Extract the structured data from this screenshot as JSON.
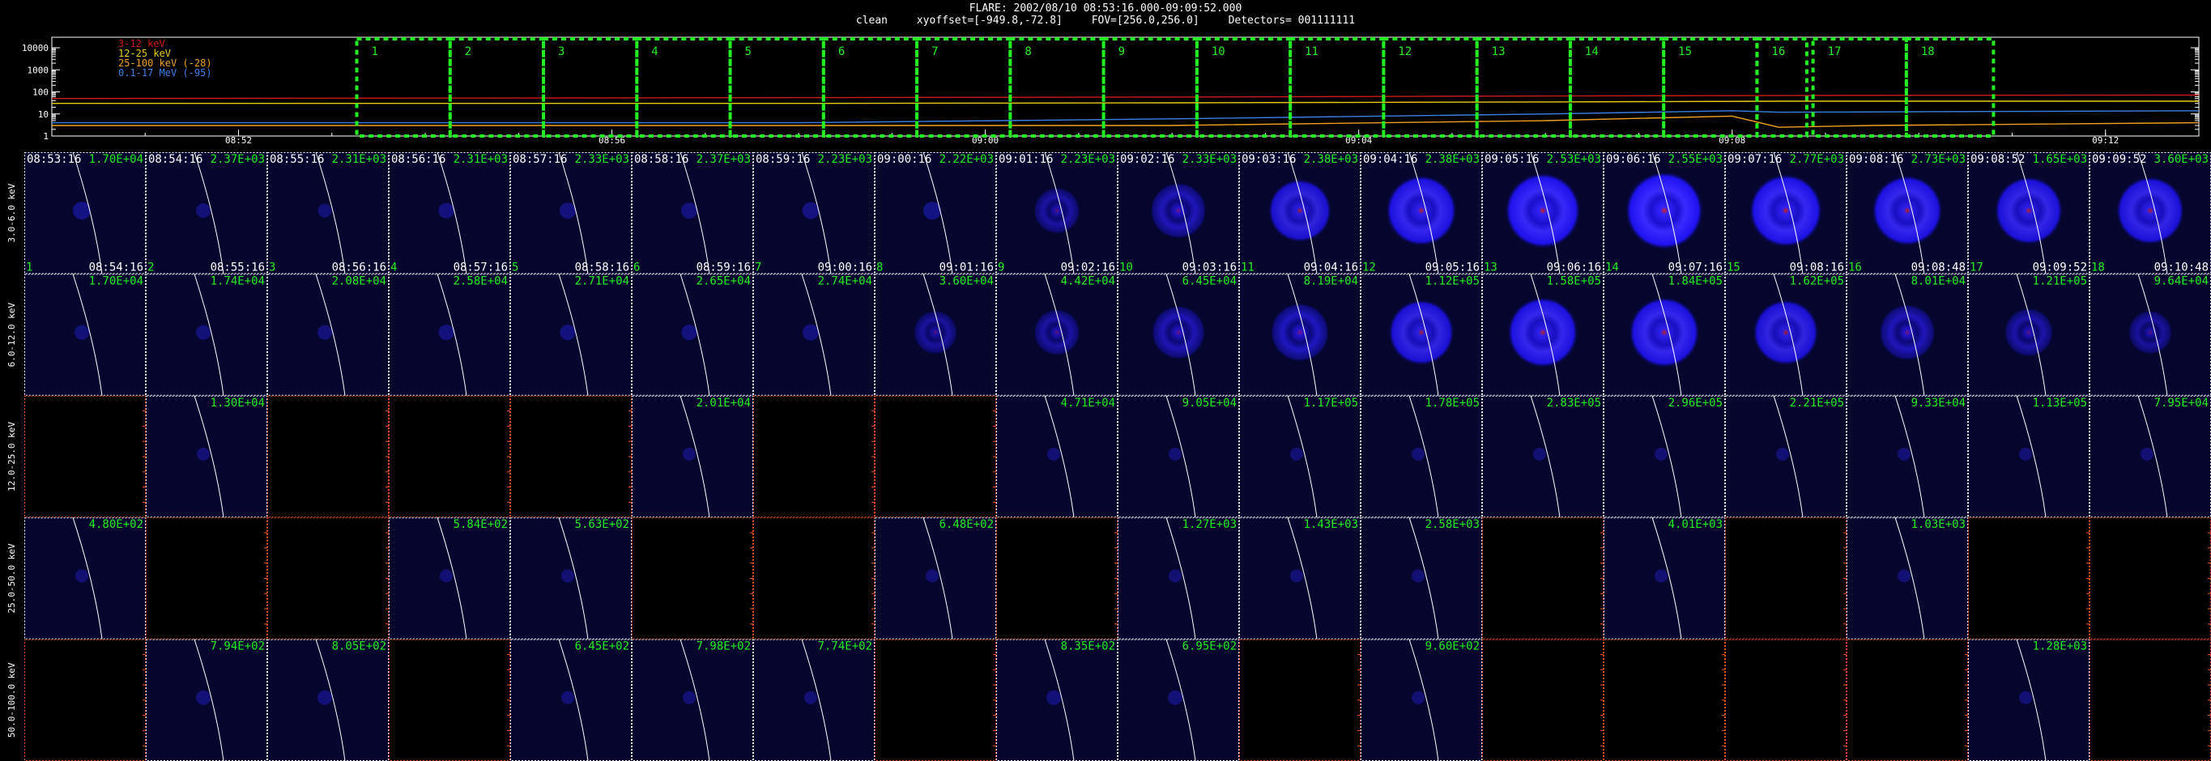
{
  "header": {
    "line1": "FLARE: 2002/08/10 08:53:16.000-09:09:52.000",
    "method": "clean",
    "xyoffset": "xyoffset=[-949.8,-72.8]",
    "fov": "FOV=[256.0,256.0]",
    "detectors": "Detectors= 001111111"
  },
  "chart_data": [
    {
      "type": "line",
      "name": "lightcurve",
      "y_scale": "log",
      "ylim": [
        1,
        30000
      ],
      "y_ticks": [
        "1",
        "10",
        "100",
        "1000",
        "10000"
      ],
      "x_range_minutes": [
        "08:50:00",
        "09:13:00"
      ],
      "x_tick_labels": [
        "08:52",
        "08:56",
        "09:00",
        "09:04",
        "09:08",
        "09:12"
      ],
      "x_tick_times": [
        "08:52:00",
        "08:56:00",
        "09:00:00",
        "09:04:00",
        "09:08:00",
        "09:12:00"
      ],
      "legend": [
        {
          "label": "3-12 keV",
          "color": "#d01a1a"
        },
        {
          "label": "12-25 keV",
          "color": "#e8cc10"
        },
        {
          "label": "25-100 keV (-28)",
          "color": "#f0a020"
        },
        {
          "label": "0.1-17 MeV (-95)",
          "color": "#3a7fe8"
        }
      ],
      "series": [
        {
          "color": "#d01a1a",
          "times": [
            "08:50:00",
            "08:54:00",
            "08:58:00",
            "09:02:00",
            "09:06:00",
            "09:10:00",
            "09:13:00"
          ],
          "values": [
            50,
            52,
            55,
            58,
            65,
            70,
            72
          ]
        },
        {
          "color": "#e8cc10",
          "times": [
            "08:50:00",
            "08:54:00",
            "08:58:00",
            "09:02:00",
            "09:06:00",
            "09:08:30",
            "09:13:00"
          ],
          "values": [
            30,
            30,
            30,
            32,
            35,
            38,
            38
          ]
        },
        {
          "color": "#f0a020",
          "times": [
            "08:50:00",
            "08:58:00",
            "09:02:00",
            "09:06:00",
            "09:08:00",
            "09:08:30",
            "09:09:30",
            "09:13:00"
          ],
          "values": [
            3,
            3,
            3,
            5,
            8,
            2.5,
            3,
            4
          ]
        },
        {
          "color": "#3a7fe8",
          "times": [
            "08:50:00",
            "08:58:00",
            "09:02:00",
            "09:06:00",
            "09:08:00",
            "09:08:30",
            "09:13:00"
          ],
          "values": [
            4,
            4,
            6,
            10,
            14,
            12,
            14
          ]
        }
      ],
      "intervals": [
        "1",
        "2",
        "3",
        "4",
        "5",
        "6",
        "7",
        "8",
        "9",
        "10",
        "11",
        "12",
        "13",
        "14",
        "15",
        "16",
        "17",
        "18"
      ]
    },
    {
      "type": "heatmap",
      "name": "image-grid",
      "energy_bands": [
        "3.0-6.0 keV",
        "6.0-12.0 keV",
        "12.0-25.0 keV",
        "25.0-50.0 keV",
        "50.0-100.0 keV"
      ],
      "start_times": [
        "08:53:16",
        "08:54:16",
        "08:55:16",
        "08:56:16",
        "08:57:16",
        "08:58:16",
        "08:59:16",
        "09:00:16",
        "09:01:16",
        "09:02:16",
        "09:03:16",
        "09:04:16",
        "09:05:16",
        "09:06:16",
        "09:07:16",
        "09:08:16",
        "09:08:52",
        "09:09:52"
      ],
      "end_times": [
        "08:54:16",
        "08:55:16",
        "08:56:16",
        "08:57:16",
        "08:58:16",
        "08:59:16",
        "09:00:16",
        "09:01:16",
        "09:02:16",
        "09:03:16",
        "09:04:16",
        "09:05:16",
        "09:06:16",
        "09:07:16",
        "09:08:16",
        "09:08:48",
        "09:09:52",
        "09:10:48"
      ],
      "maxima": [
        [
          "1.70E+04",
          "2.37E+03",
          "2.31E+03",
          "2.31E+03",
          "2.33E+03",
          "2.37E+03",
          "2.23E+03",
          "2.22E+03",
          "2.23E+03",
          "2.33E+03",
          "2.38E+03",
          "2.38E+03",
          "2.53E+03",
          "2.55E+03",
          "2.77E+03",
          "2.73E+03",
          "1.65E+03",
          "3.60E+03"
        ],
        [
          "1.70E+04",
          "1.74E+04",
          "2.08E+04",
          "2.58E+04",
          "2.71E+04",
          "2.65E+04",
          "2.74E+04",
          "3.60E+04",
          "4.42E+04",
          "6.45E+04",
          "8.19E+04",
          "1.12E+05",
          "1.58E+05",
          "1.84E+05",
          "1.62E+05",
          "8.01E+04",
          "1.21E+05",
          "9.64E+04"
        ],
        [
          "",
          "1.30E+04",
          "",
          "",
          "",
          "2.01E+04",
          "",
          "",
          "4.71E+04",
          "9.05E+04",
          "1.17E+05",
          "1.78E+05",
          "2.83E+05",
          "2.96E+05",
          "2.21E+05",
          "9.33E+04",
          "1.13E+05",
          "7.95E+04"
        ],
        [
          "4.80E+02",
          "",
          "",
          "5.84E+02",
          "5.63E+02",
          "",
          "",
          "6.48E+02",
          "",
          "1.27E+03",
          "1.43E+03",
          "2.58E+03",
          "",
          "4.01E+03",
          "",
          "1.03E+03",
          "",
          ""
        ],
        [
          "",
          "7.94E+02",
          "8.05E+02",
          "",
          "6.45E+02",
          "7.98E+02",
          "7.74E+02",
          "",
          "8.35E+02",
          "6.95E+02",
          "",
          "9.60E+02",
          "",
          "",
          "",
          "",
          "1.28E+03",
          ""
        ]
      ],
      "emission": [
        [
          0.25,
          0.15,
          0.12,
          0.18,
          0.2,
          0.2,
          0.22,
          0.25,
          0.35,
          0.55,
          0.7,
          0.85,
          0.95,
          1.0,
          0.9,
          0.85,
          0.8,
          0.8
        ],
        [
          0.15,
          0.15,
          0.15,
          0.18,
          0.18,
          0.18,
          0.2,
          0.3,
          0.35,
          0.5,
          0.6,
          0.75,
          0.85,
          0.85,
          0.75,
          0.55,
          0.4,
          0.3
        ],
        [
          0,
          0.1,
          0,
          0,
          0,
          0.1,
          0,
          0,
          0.1,
          0.1,
          0.1,
          0.1,
          0.1,
          0.1,
          0.1,
          0.1,
          0.1,
          0.1
        ],
        [
          0.1,
          0,
          0,
          0.1,
          0.1,
          0,
          0,
          0.1,
          0,
          0.1,
          0.1,
          0.1,
          0,
          0.1,
          0,
          0.1,
          0,
          0
        ],
        [
          0,
          0.15,
          0.15,
          0,
          0.1,
          0.1,
          0.1,
          0,
          0.15,
          0.15,
          0,
          0.1,
          0,
          0,
          0,
          0,
          0.1,
          0
        ]
      ]
    }
  ]
}
